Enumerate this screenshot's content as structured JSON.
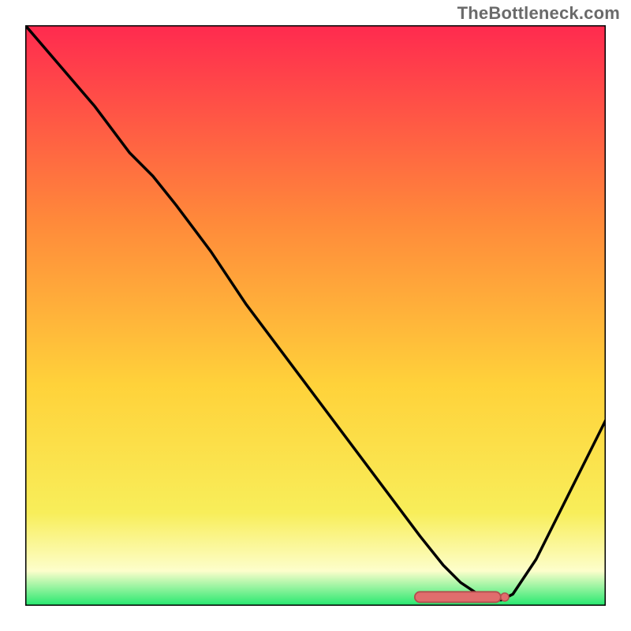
{
  "watermark": "TheBottleneck.com",
  "colors": {
    "grad_top": "#ff2a4f",
    "grad_mid1": "#ff8a3a",
    "grad_mid2": "#ffd23a",
    "grad_mid3": "#f8ee5a",
    "grad_near_bottom": "#fdfecb",
    "grad_bottom": "#23e86e",
    "curve": "#000000",
    "marker_fill": "#e06d6d",
    "marker_stroke": "#b34e4e",
    "frame": "#000000"
  },
  "chart_data": {
    "type": "line",
    "title": "",
    "xlabel": "",
    "ylabel": "",
    "xlim": [
      0,
      100
    ],
    "ylim": [
      0,
      100
    ],
    "grid": false,
    "legend": false,
    "series": [
      {
        "name": "bottleneck-curve",
        "x": [
          0,
          6,
          12,
          18,
          22,
          26,
          32,
          38,
          44,
          50,
          56,
          62,
          68,
          72,
          75,
          78,
          80,
          82,
          84,
          88,
          92,
          96,
          100
        ],
        "y": [
          100,
          93,
          86,
          78,
          74,
          69,
          61,
          52,
          44,
          36,
          28,
          20,
          12,
          7,
          4,
          2,
          1,
          1,
          2,
          8,
          16,
          24,
          32
        ]
      }
    ],
    "markers": {
      "name": "optimal-range-markers",
      "x": [
        68,
        70,
        72,
        74,
        76,
        78,
        81
      ],
      "y": [
        1.5,
        1.5,
        1.5,
        1.5,
        1.5,
        1.5,
        1.5
      ]
    },
    "gradient_bands": [
      {
        "y0": 100,
        "y1": 70,
        "color_top": "#ff2a4f",
        "color_bottom": "#ff8a3a"
      },
      {
        "y0": 70,
        "y1": 40,
        "color_top": "#ff8a3a",
        "color_bottom": "#ffd23a"
      },
      {
        "y0": 40,
        "y1": 12,
        "color_top": "#ffd23a",
        "color_bottom": "#f8ee5a"
      },
      {
        "y0": 12,
        "y1": 4,
        "color_top": "#f8ee5a",
        "color_bottom": "#fdfecb"
      },
      {
        "y0": 4,
        "y1": 0,
        "color_top": "#fdfecb",
        "color_bottom": "#23e86e"
      }
    ]
  }
}
